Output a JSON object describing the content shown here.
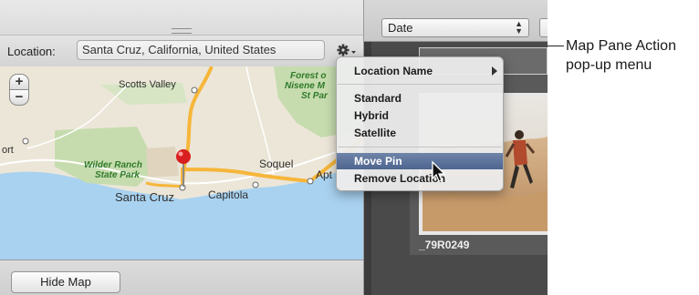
{
  "location_bar": {
    "label": "Location:",
    "value": "Santa Cruz, California, United States",
    "action_icon": "gear-icon"
  },
  "map": {
    "zoom_in": "+",
    "zoom_out": "−",
    "places": {
      "scotts_valley": "Scotts Valley",
      "forest": "Forest o",
      "nisene": "Nisene M",
      "st_park": "St Par",
      "wilder_1": "Wilder Ranch",
      "wilder_2": "State Park",
      "santa_cruz": "Santa Cruz",
      "capitola": "Capitola",
      "soquel": "Soquel",
      "aptos": "Apt",
      "port": "ort"
    },
    "pin_color": "#d81e1e"
  },
  "bottom_bar": {
    "hide_map": "Hide Map"
  },
  "browser": {
    "sort_value": "Date",
    "thumbnail_name": "_79R0249"
  },
  "popup_menu": {
    "items": [
      {
        "label": "Location Name",
        "has_submenu": true
      },
      {
        "label": "Standard"
      },
      {
        "label": "Hybrid"
      },
      {
        "label": "Satellite"
      },
      {
        "label": "Move Pin",
        "selected": true
      },
      {
        "label": "Remove Location"
      }
    ]
  },
  "callout": {
    "line1": "Map Pane Action",
    "line2": "pop-up menu"
  },
  "colors": {
    "water": "#a9d2f0",
    "land": "#ece6d8",
    "park": "#c6dcae",
    "highway": "#f6b63a",
    "menu_highlight": "#5b729c"
  }
}
